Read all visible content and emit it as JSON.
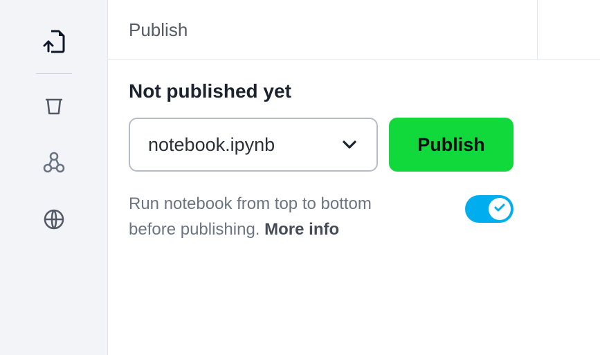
{
  "header": {
    "title": "Publish"
  },
  "panel": {
    "status": "Not published yet",
    "file_selector": {
      "selected": "notebook.ipynb"
    },
    "publish_button_label": "Publish",
    "option": {
      "description": "Run notebook from top to bottom before publishing.",
      "more_info_label": "More info",
      "enabled": true
    }
  },
  "sidebar": {
    "items": [
      {
        "id": "publish",
        "icon": "file-upload"
      },
      {
        "id": "trash",
        "icon": "trash"
      },
      {
        "id": "share",
        "icon": "share-nodes"
      },
      {
        "id": "web",
        "icon": "globe"
      }
    ]
  },
  "colors": {
    "accent_green": "#12d93b",
    "toggle_blue": "#00aeef"
  }
}
